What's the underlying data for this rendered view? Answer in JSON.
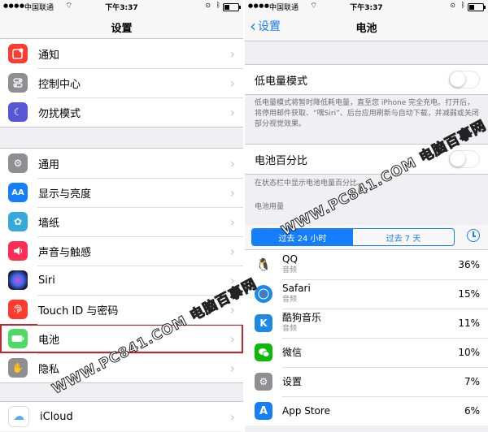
{
  "status_bar": {
    "left_screen": {
      "carrier": "中国联通",
      "time": "下午3:37"
    },
    "right_screen": {
      "carrier": "中国联通",
      "time": "下午3:37"
    }
  },
  "settings_screen": {
    "title": "设置",
    "group1": [
      {
        "label": "通知",
        "icon": "notifications-icon",
        "color": "#ff3b30"
      },
      {
        "label": "控制中心",
        "icon": "control-center-icon",
        "color": "#8e8e93"
      },
      {
        "label": "勿扰模式",
        "icon": "moon-icon",
        "color": "#5856d6"
      }
    ],
    "group2": [
      {
        "label": "通用",
        "icon": "gear-icon",
        "color": "#8e8e93"
      },
      {
        "label": "显示与亮度",
        "icon": "display-brightness-icon",
        "color": "#157efb",
        "glyph": "AA"
      },
      {
        "label": "墙纸",
        "icon": "wallpaper-icon",
        "color": "#34aadc"
      },
      {
        "label": "声音与触感",
        "icon": "speaker-icon",
        "color": "#ff2d55"
      },
      {
        "label": "Siri",
        "icon": "siri-icon",
        "color": "#1c1c3c"
      },
      {
        "label": "Touch ID 与密码",
        "icon": "fingerprint-icon",
        "color": "#ff3b30"
      },
      {
        "label": "电池",
        "icon": "battery-icon",
        "color": "#4cd964",
        "highlighted": true
      },
      {
        "label": "隐私",
        "icon": "hand-icon",
        "color": "#8e8e93"
      }
    ],
    "group3": [
      {
        "label": "iCloud",
        "icon": "icloud-icon",
        "color": "#ffffff"
      }
    ]
  },
  "battery_screen": {
    "back_label": "设置",
    "title": "电池",
    "low_power_label": "低电量模式",
    "low_power_note": "低电量模式将暂时降低耗电量，直至您 iPhone 完全充电。打开后，将停用邮件获取、“嘿Siri”、后台应用刷新与自动下载，并减弱或关闭部分视觉效果。",
    "percentage_label": "电池百分比",
    "percentage_note": "在状态栏中显示电池电量百分比。",
    "usage_header": "电池用量",
    "segments": [
      "过去 24 小时",
      "过去 7 天"
    ],
    "selected_segment": 0,
    "apps": [
      {
        "name": "QQ",
        "sub": "音频",
        "percent": "36%",
        "icon": "qq-penguin-icon",
        "color": "#ffffff"
      },
      {
        "name": "Safari",
        "sub": "音频",
        "percent": "15%",
        "icon": "safari-compass-icon",
        "color": "#1e88e5"
      },
      {
        "name": "酷狗音乐",
        "sub": "音频",
        "percent": "11%",
        "icon": "kugou-k-icon",
        "color": "#1e88e5"
      },
      {
        "name": "微信",
        "sub": "",
        "percent": "10%",
        "icon": "wechat-icon",
        "color": "#09bb07"
      },
      {
        "name": "设置",
        "sub": "",
        "percent": "7%",
        "icon": "gear-icon",
        "color": "#8e8e93"
      },
      {
        "name": "App Store",
        "sub": "",
        "percent": "6%",
        "icon": "app-store-icon",
        "color": "#157efb"
      }
    ]
  },
  "watermark": {
    "text": "WWW.PC841.COM 电脑百事网"
  }
}
